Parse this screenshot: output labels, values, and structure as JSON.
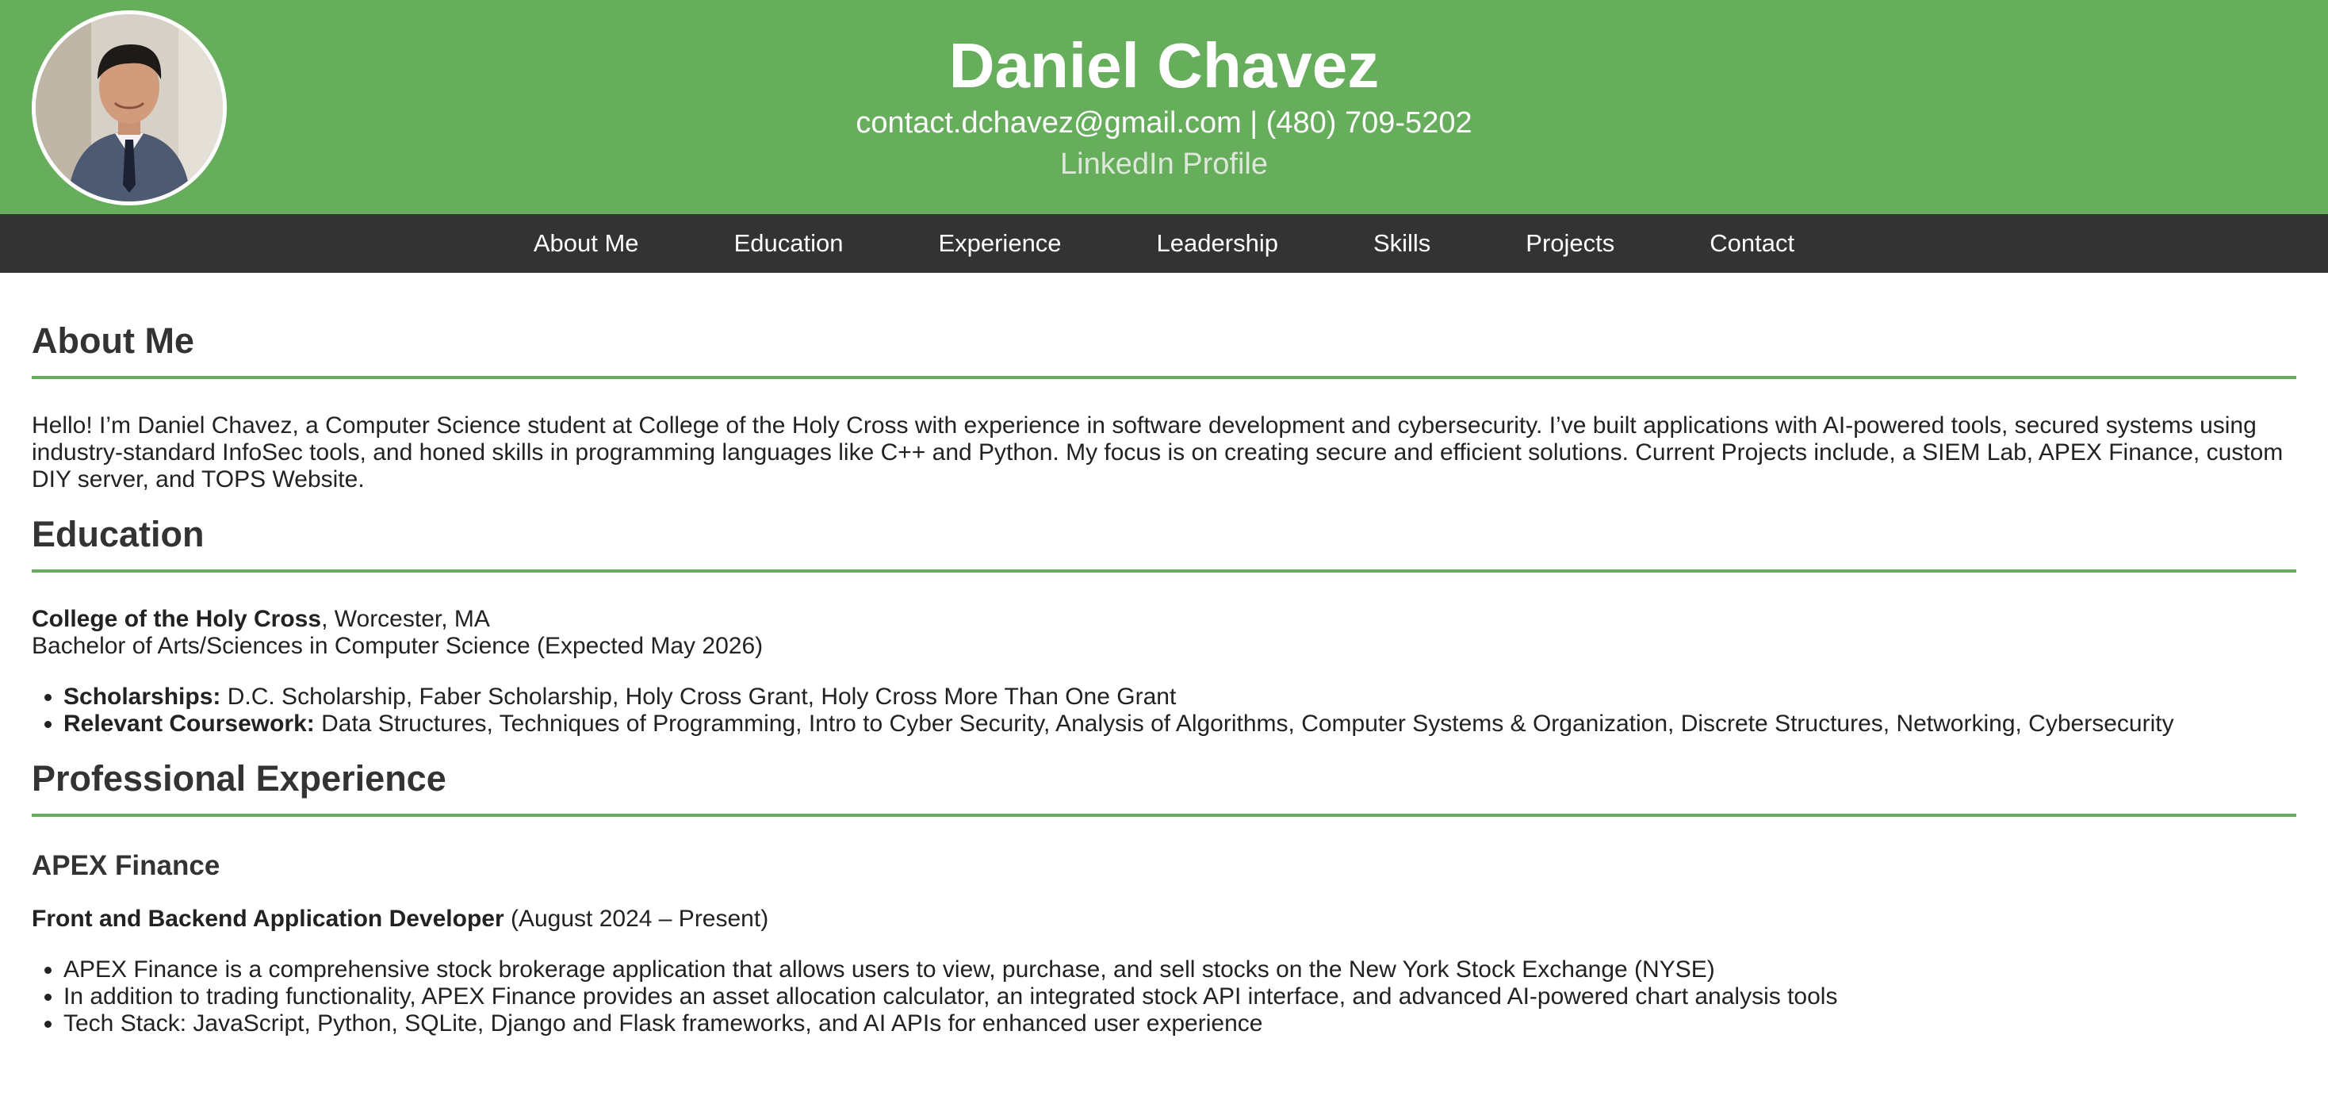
{
  "header": {
    "name": "Daniel Chavez",
    "email": "contact.dchavez@gmail.com",
    "separator": "|",
    "phone": "(480) 709-5202",
    "linkedin_label": "LinkedIn Profile",
    "background_color": "#67ae5c",
    "avatar_icon": "profile-photo"
  },
  "nav": {
    "items": [
      "About Me",
      "Education",
      "Experience",
      "Leadership",
      "Skills",
      "Projects",
      "Contact"
    ],
    "background_color": "#333333"
  },
  "about": {
    "title": "About Me",
    "text": "Hello! I’m Daniel Chavez, a Computer Science student at College of the Holy Cross with experience in software development and cybersecurity. I’ve built applications with AI-powered tools, secured systems using industry-standard InfoSec tools, and honed skills in programming languages like C++ and Python. My focus is on creating secure and efficient solutions. Current Projects include, a SIEM Lab, APEX Finance, custom DIY server, and TOPS Website."
  },
  "education": {
    "title": "Education",
    "school": "College of the Holy Cross",
    "location": ", Worcester, MA",
    "degree": "Bachelor of Arts/Sciences in Computer Science (Expected May 2026)",
    "scholarships_label": "Scholarships:",
    "scholarships": " D.C. Scholarship, Faber Scholarship, Holy Cross Grant, Holy Cross More Than One Grant",
    "coursework_label": "Relevant Coursework:",
    "coursework": " Data Structures, Techniques of Programming, Intro to Cyber Security, Analysis of Algorithms, Computer Systems & Organization, Discrete Structures, Networking, Cybersecurity"
  },
  "experience": {
    "title": "Professional Experience",
    "jobs": [
      {
        "org": "APEX Finance",
        "role": "Front and Backend Application Developer",
        "dates": " (August 2024 – Present)",
        "bullets": [
          "APEX Finance is a comprehensive stock brokerage application that allows users to view, purchase, and sell stocks on the New York Stock Exchange (NYSE)",
          "In addition to trading functionality, APEX Finance provides an asset allocation calculator, an integrated stock API interface, and advanced AI-powered chart analysis tools",
          "Tech Stack: JavaScript, Python, SQLite, Django and Flask frameworks, and AI APIs for enhanced user experience"
        ]
      }
    ]
  },
  "accent_color": "#67ae5c"
}
